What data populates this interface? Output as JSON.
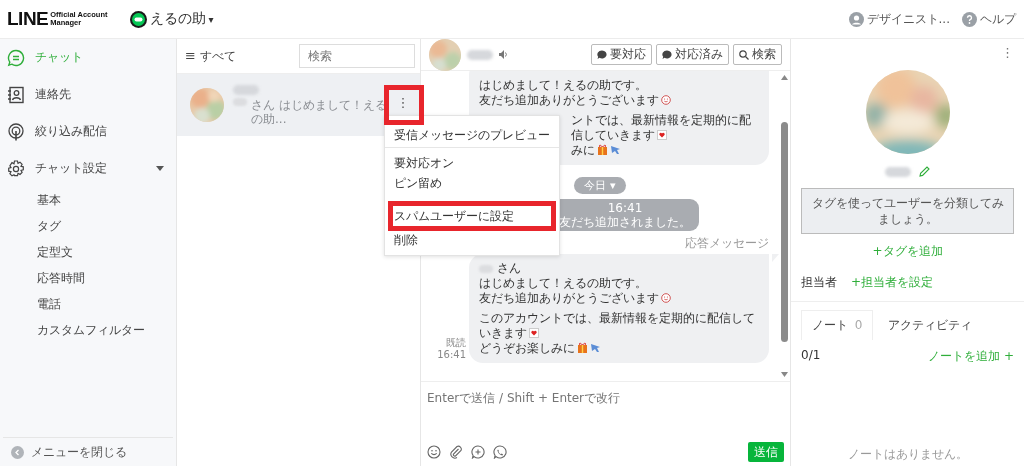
{
  "header": {
    "logo": "LINE",
    "logo_sub": [
      "Official Account",
      "Manager"
    ],
    "account": "えるの助",
    "account_caret": "▾",
    "user": "デザイニスト...",
    "help": "ヘルプ"
  },
  "sidebar": {
    "items": [
      {
        "label": "チャット",
        "selected": true
      },
      {
        "label": "連絡先",
        "selected": false
      },
      {
        "label": "絞り込み配信",
        "selected": false
      },
      {
        "label": "チャット設定",
        "selected": false,
        "expanded": true,
        "children": [
          {
            "label": "基本",
            "selected": false
          },
          {
            "label": "タグ",
            "selected": false
          },
          {
            "label": "定型文",
            "selected": false
          },
          {
            "label": "応答時間",
            "selected": false
          },
          {
            "label": "電話",
            "selected": false
          },
          {
            "label": "カスタムフィルター",
            "selected": false
          }
        ]
      }
    ],
    "close": "メニューを閉じる"
  },
  "chat_list": {
    "filter_glyph": "≡",
    "filter": "すべて",
    "search": {
      "placeholder": "検索"
    },
    "rows": [
      {
        "preview": "さん はじめまして！えるの助...",
        "selected": true,
        "menu_button": {
          "label": "⋮",
          "highlighted": true
        }
      }
    ]
  },
  "context_menu": {
    "groups": [
      {
        "items": [
          {
            "label": "受信メッセージのプレビュー",
            "highlighted": false
          }
        ]
      },
      {
        "items": [
          {
            "label": "要対応オン",
            "highlighted": false
          },
          {
            "label": "ピン留め",
            "highlighted": false
          }
        ]
      },
      {
        "items": [
          {
            "label": "スパムユーザーに設定",
            "highlighted": true
          },
          {
            "label": "削除",
            "highlighted": false
          }
        ]
      }
    ]
  },
  "chat": {
    "buttons": [
      {
        "label": "要対応"
      },
      {
        "label": "対応済み"
      },
      {
        "label": "検索"
      }
    ],
    "messages": [
      {
        "kind": "bubble",
        "lines": [
          {
            "text": "はじめまして！えるの助です。",
            "covered": false,
            "gap_before": false
          },
          {
            "text": "友だち追加ありがとうございます",
            "covered": false,
            "gap_before": false
          },
          {
            "text": "ントでは、最新情報を定期的に配信していきます",
            "covered": true,
            "gap_before": true
          },
          {
            "text": "みに",
            "covered": true,
            "gap_before": false
          }
        ]
      },
      {
        "kind": "date",
        "label": "今日",
        "caret": "▾"
      },
      {
        "kind": "system",
        "time": "16:41",
        "text": "友だち追加されました。"
      },
      {
        "kind": "label",
        "text": "応答メッセージ"
      },
      {
        "kind": "bubble",
        "name_suffix": "さん",
        "read": "既読",
        "time": "16:41",
        "lines": [
          {
            "text": "はじめまして！えるの助です。",
            "covered": false,
            "gap_before": false
          },
          {
            "text": "友だち追加ありがとうございます",
            "covered": false,
            "gap_before": false
          },
          {
            "text": "このアカウントでは、最新情報を定期的に配信していきます",
            "covered": false,
            "gap_before": true
          },
          {
            "text": "どうぞお楽しみに",
            "covered": false,
            "gap_before": false
          }
        ]
      }
    ],
    "input": {
      "placeholder": "Enterで送信 / Shift + Enterで改行"
    },
    "send": "送信"
  },
  "profile": {
    "more": "⋮",
    "tag_hint": "タグを使ってユーザーを分類してみましょう。",
    "add_tag": "+タグを追加",
    "assignee_label": "担当者",
    "set_assignee": "+担当者を設定",
    "tabs": [
      {
        "label": "ノート",
        "count": "0",
        "selected": true
      },
      {
        "label": "アクティビティ",
        "selected": false
      }
    ],
    "note_count": "0/1",
    "add_note": "ノートを追加 +",
    "empty": "ノートはありません。"
  }
}
